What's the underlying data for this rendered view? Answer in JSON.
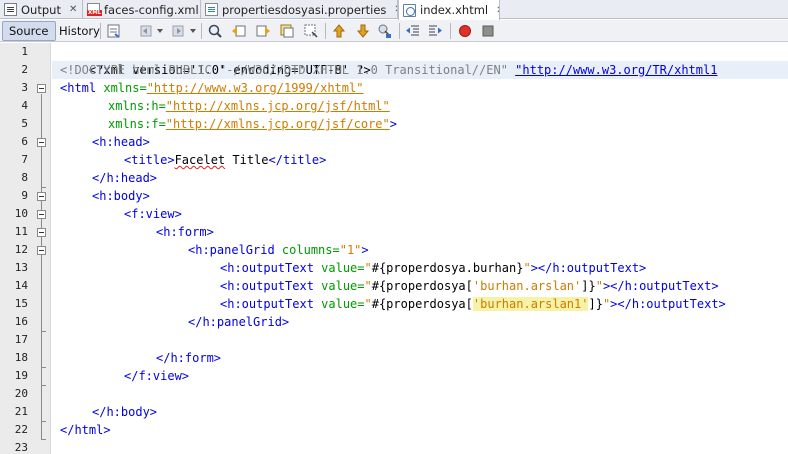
{
  "tabs": [
    {
      "label": "Output",
      "icon": "output-icon",
      "active": false
    },
    {
      "label": "faces-config.xml",
      "icon": "xml-file-icon",
      "active": false
    },
    {
      "label": "propertiesdosyasi.properties",
      "icon": "properties-file-icon",
      "active": false
    },
    {
      "label": "index.xhtml",
      "icon": "xhtml-file-icon",
      "active": true
    }
  ],
  "toolbar": {
    "source_label": "Source",
    "history_label": "History"
  },
  "editor": {
    "line_numbers": [
      "1",
      "2",
      "3",
      "4",
      "5",
      "6",
      "7",
      "8",
      "9",
      "10",
      "11",
      "12",
      "13",
      "14",
      "15",
      "16",
      "17",
      "18",
      "19",
      "20",
      "21",
      "22",
      "23"
    ],
    "current_line": 2
  },
  "code": {
    "l1": "<?xml version='1.0' encoding='UTF-8' ?>",
    "l2_doctype": "<!DOCTYPE html PUBLIC \"-//W3C//DTD XHTML 1.0 Transitional//EN\" ",
    "l2_url": "\"http://www.w3.org/TR/xhtml1",
    "l3_tag": "<html",
    "l3_attr": " xmlns=",
    "l3_val": "\"http://www.w3.org/1999/xhtml\"",
    "l4_attr": "xmlns:h=",
    "l4_val": "\"http://xmlns.jcp.org/jsf/html\"",
    "l5_attr": "xmlns:f=",
    "l5_val": "\"http://xmlns.jcp.org/jsf/core\"",
    "l5_end": ">",
    "l6": "<h:head>",
    "l7_open": "<title>",
    "l7_text1": "Facelet",
    "l7_text2": " Title",
    "l7_close": "</title>",
    "l8": "</h:head>",
    "l9": "<h:body>",
    "l10": "<f:view>",
    "l11": "<h:form>",
    "l12_tag": "<h:panelGrid",
    "l12_attr": " columns=",
    "l12_val": "\"1\"",
    "l12_end": ">",
    "l13_tag": "<h:outputText",
    "l13_attr": " value=",
    "l13_q": "\"",
    "l13_expr": "#{properdosya.burhan}",
    "l13_q2": "\"",
    "l13_end": "></h:outputText>",
    "l14_tag": "<h:outputText",
    "l14_attr": " value=",
    "l14_q": "\"",
    "l14_expr1": "#{properdosya[",
    "l14_str": "'burhan.arslan'",
    "l14_expr2": "]}",
    "l14_q2": "\"",
    "l14_end": "></h:outputText>",
    "l15_tag": "<h:outputText",
    "l15_attr": " value=",
    "l15_q": "\"",
    "l15_expr1": "#{properdosya[",
    "l15_str": "'burhan.arslan1'",
    "l15_expr2": "]}",
    "l15_q2": "\"",
    "l15_end": "></h:outputText>",
    "l16": "</h:panelGrid>",
    "l18": "</h:form>",
    "l19": "</f:view>",
    "l21": "</h:body>",
    "l22": "</html>"
  }
}
